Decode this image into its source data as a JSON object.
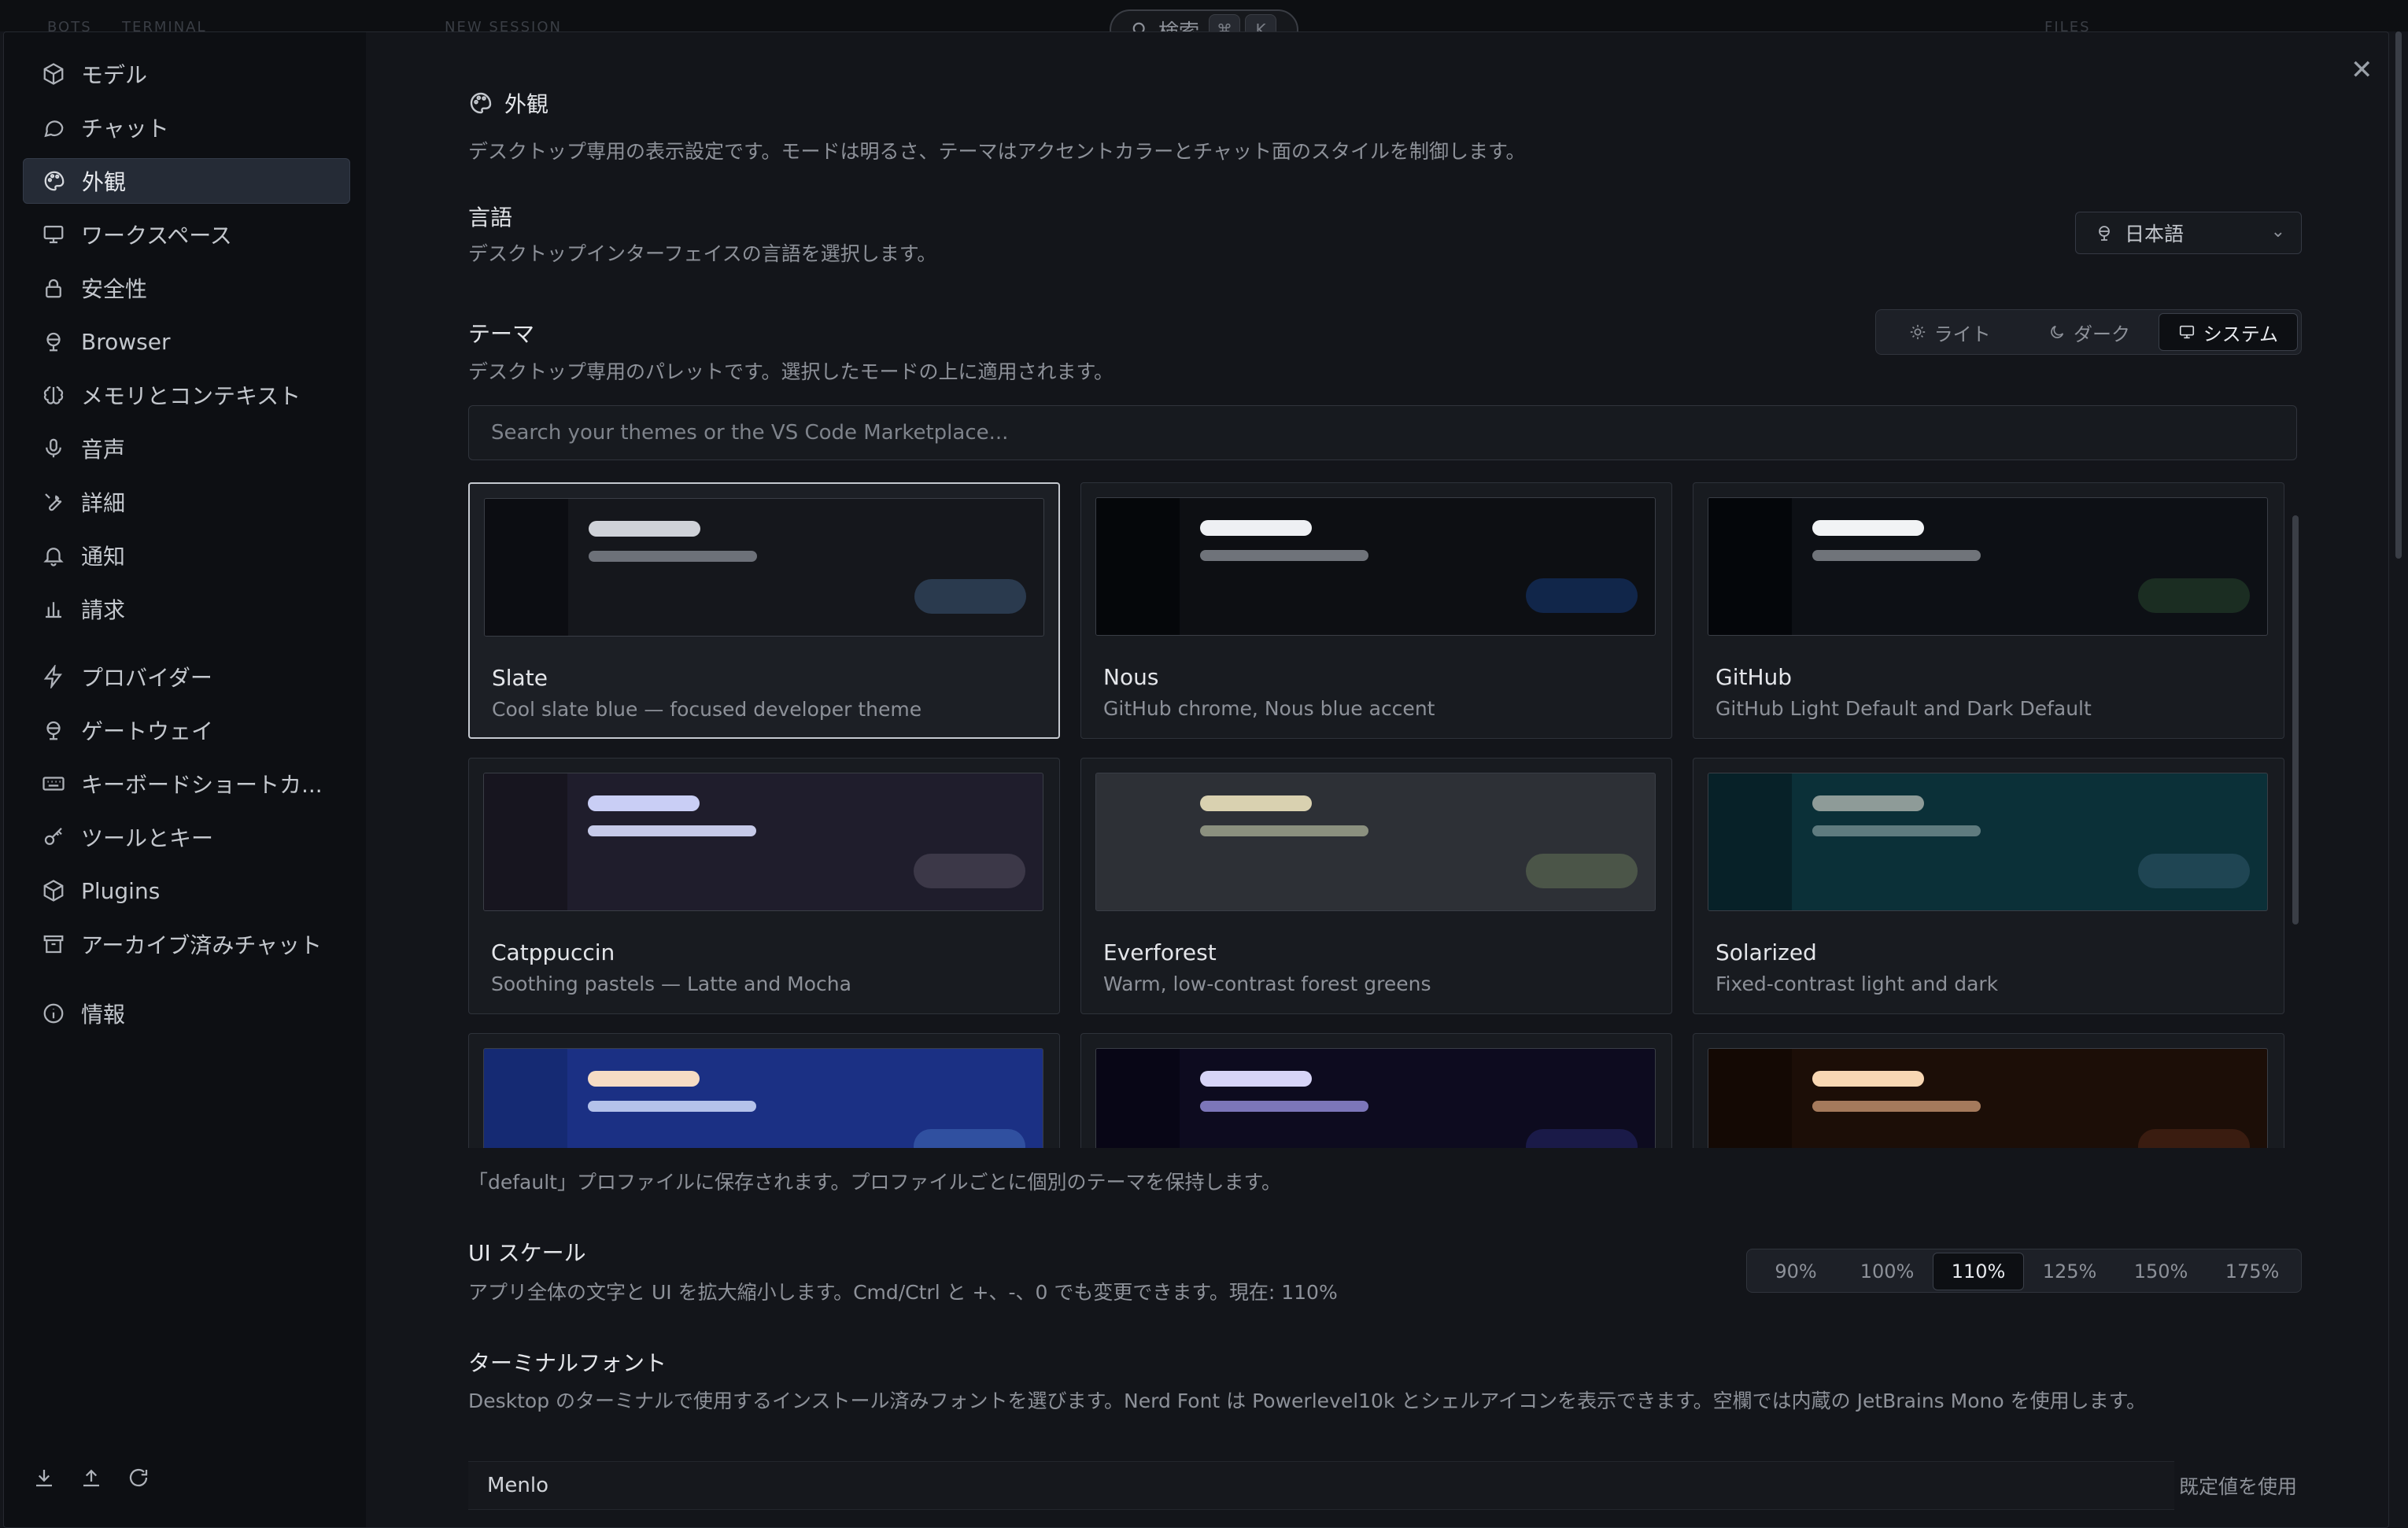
{
  "background": {
    "tabs": [
      "BOTS",
      "TERMINAL",
      "NEW SESSION",
      "FILES"
    ],
    "search": {
      "label": "検索",
      "keys": [
        "⌘",
        "K"
      ]
    }
  },
  "sidebar": {
    "items": [
      {
        "label": "モデル",
        "icon": "cube-icon"
      },
      {
        "label": "チャット",
        "icon": "chat-bubble-icon"
      },
      {
        "label": "外観",
        "icon": "palette-icon",
        "active": true
      },
      {
        "label": "ワークスペース",
        "icon": "monitor-icon"
      },
      {
        "label": "安全性",
        "icon": "lock-icon"
      },
      {
        "label": "Browser",
        "icon": "globe-icon"
      },
      {
        "label": "メモリとコンテキスト",
        "icon": "brain-icon"
      },
      {
        "label": "音声",
        "icon": "microphone-icon"
      },
      {
        "label": "詳細",
        "icon": "wrench-icon"
      },
      {
        "label": "通知",
        "icon": "bell-icon"
      },
      {
        "label": "請求",
        "icon": "bar-chart-icon"
      },
      {
        "label": "プロバイダー",
        "icon": "lightning-icon"
      },
      {
        "label": "ゲートウェイ",
        "icon": "globe-icon"
      },
      {
        "label": "キーボードショートカ...",
        "icon": "keyboard-icon"
      },
      {
        "label": "ツールとキー",
        "icon": "key-icon"
      },
      {
        "label": "Plugins",
        "icon": "package-icon"
      },
      {
        "label": "アーカイブ済みチャット",
        "icon": "archive-icon"
      },
      {
        "label": "情報",
        "icon": "info-icon"
      }
    ],
    "bottom_icons": [
      "download-icon",
      "upload-icon",
      "refresh-icon"
    ]
  },
  "appearance": {
    "title": "外観",
    "description": "デスクトップ専用の表示設定です。モードは明るさ、テーマはアクセントカラーとチャット面のスタイルを制御します。"
  },
  "language": {
    "title": "言語",
    "description": "デスクトップインターフェイスの言語を選択します。",
    "selected": "日本語"
  },
  "theme": {
    "title": "テーマ",
    "description": "デスクトップ専用のパレットです。選択したモードの上に適用されます。",
    "modes": [
      {
        "label": "ライト",
        "icon": "sun-icon"
      },
      {
        "label": "ダーク",
        "icon": "moon-icon"
      },
      {
        "label": "システム",
        "icon": "monitor-icon",
        "active": true
      }
    ],
    "search_placeholder": "Search your themes or the VS Code Marketplace...",
    "cards": [
      {
        "name": "Slate",
        "desc": "Cool slate blue — focused developer theme",
        "selected": true,
        "colors": {
          "bg": "#15171c",
          "side": "#0c0d12",
          "bar1": "#cfd2d8",
          "bar2": "#6d7179",
          "pill": "#2a3a4e"
        }
      },
      {
        "name": "Nous",
        "desc": "GitHub chrome, Nous blue accent",
        "colors": {
          "bg": "#0d0f13",
          "side": "#05070a",
          "bar1": "#eef0f3",
          "bar2": "#6f737a",
          "pill": "#11264a"
        }
      },
      {
        "name": "GitHub",
        "desc": "GitHub Light Default and Dark Default",
        "colors": {
          "bg": "#0d1015",
          "side": "#04060a",
          "bar1": "#f1f3f5",
          "bar2": "#70747a",
          "pill": "#1b2d22"
        }
      },
      {
        "name": "Catppuccin",
        "desc": "Soothing pastels — Latte and Mocha",
        "colors": {
          "bg": "#1f1d2c",
          "side": "#17151f",
          "bar1": "#c9cef5",
          "bar2": "#c6cae9",
          "pill": "#3c3848"
        }
      },
      {
        "name": "Everforest",
        "desc": "Warm, low-contrast forest greens",
        "colors": {
          "bg": "#2d3036",
          "side": "#2d3036",
          "bar1": "#d9d1b0",
          "bar2": "#8b907f",
          "pill": "#4b5548"
        }
      },
      {
        "name": "Solarized",
        "desc": "Fixed-contrast light and dark",
        "colors": {
          "bg": "#0b3038",
          "side": "#072128",
          "bar1": "#8e9b98",
          "bar2": "#5f7b7f",
          "pill": "#1f4553"
        }
      },
      {
        "name": "",
        "desc": "",
        "colors": {
          "bg": "#1b3084",
          "side": "#152a73",
          "bar1": "#f6dcc4",
          "bar2": "#b4c2ea",
          "pill": "#3050a0"
        }
      },
      {
        "name": "",
        "desc": "",
        "colors": {
          "bg": "#0d0b1f",
          "side": "#080616",
          "bar1": "#d7d4f7",
          "bar2": "#7c76b9",
          "pill": "#1a1a48"
        }
      },
      {
        "name": "",
        "desc": "",
        "colors": {
          "bg": "#1c0e07",
          "side": "#140904",
          "bar1": "#f8d7b3",
          "bar2": "#a57a5c",
          "pill": "#3a1c10"
        }
      }
    ],
    "profile_note": "「default」プロファイルに保存されます。プロファイルごとに個別のテーマを保持します。"
  },
  "ui_scale": {
    "title": "UI スケール",
    "description": "アプリ全体の文字と UI を拡大縮小します。Cmd/Ctrl と +、-、0 でも変更できます。現在: 110%",
    "options": [
      "90%",
      "100%",
      "110%",
      "125%",
      "150%",
      "175%"
    ],
    "selected": "110%"
  },
  "terminal_font": {
    "title": "ターミナルフォント",
    "description": "Desktop のターミナルで使用するインストール済みフォントを選びます。Nerd Font は Powerlevel10k とシェルアイコンを表示できます。空欄では内蔵の JetBrains Mono を使用します。",
    "value": "Menlo",
    "default_button": "既定値を使用"
  }
}
